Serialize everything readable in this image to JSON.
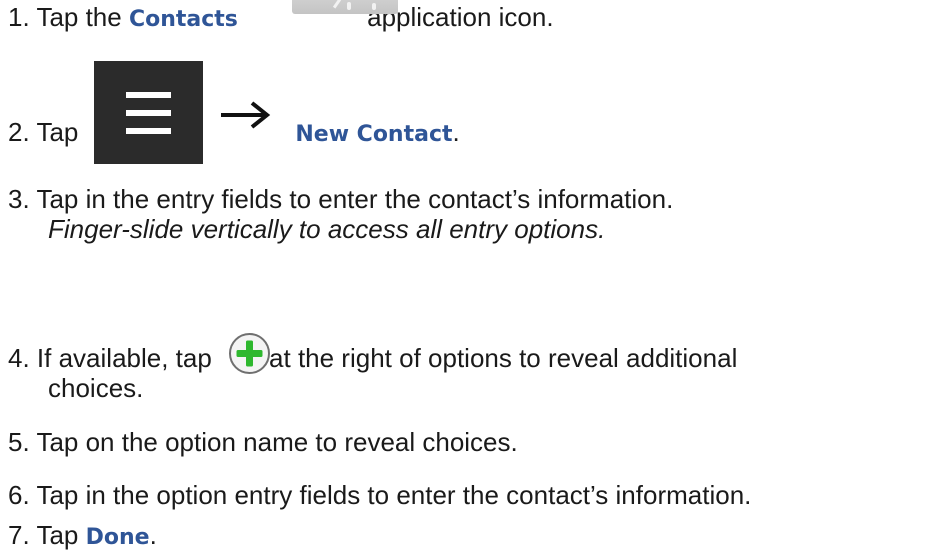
{
  "steps": {
    "s1": {
      "num": "1. ",
      "pre": "Tap the ",
      "term": "Contacts",
      "post": " application icon."
    },
    "s2": {
      "num": "2. ",
      "pre": "Tap",
      "term": "New Contact",
      "post": "."
    },
    "s3": {
      "num": "3. ",
      "text": "Tap in the entry fields to enter the contact’s information.",
      "note": "Finger-slide vertically to access all entry options."
    },
    "s4": {
      "num": "4. ",
      "pre": "If available, tap",
      "post": " at the right of options to reveal additional",
      "cont": "choices."
    },
    "s5": {
      "num": "5. ",
      "text": "Tap on the option name to reveal choices."
    },
    "s6": {
      "num": "6. ",
      "text": "Tap in the option entry fields to enter the contact’s information."
    },
    "s7": {
      "num": "7. ",
      "pre": "Tap ",
      "term": "Done",
      "post": "."
    }
  },
  "icons": {
    "contacts": "contacts-app-icon",
    "menu": "menu-icon",
    "arrow": "arrow-right-icon",
    "add": "plus-circle-icon"
  },
  "colors": {
    "term": "#2f5597",
    "menu_bg": "#2b2b2b",
    "plus_green": "#2eb82e"
  }
}
